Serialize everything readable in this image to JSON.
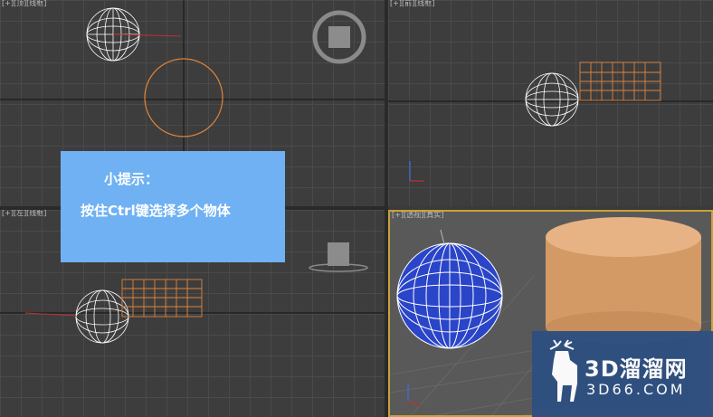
{
  "viewports": {
    "top": {
      "label": "[+][顶][线框]"
    },
    "front": {
      "label": "[+][前][线框]"
    },
    "left": {
      "label": "[+][左][线框]"
    },
    "perspective": {
      "label": "[+][透视][真实]"
    }
  },
  "tip": {
    "title": "小提示：",
    "body": "按住Ctrl键选择多个物体"
  },
  "watermark": {
    "name": "3D溜溜网",
    "url": "3D66.COM"
  },
  "colors": {
    "selection_border": "#c8a23a",
    "tip_background": "#6fb1f2",
    "wireframe_orange": "#e0843a",
    "sphere_blue": "#2a45c8",
    "cylinder_tan": "#e2a876"
  }
}
